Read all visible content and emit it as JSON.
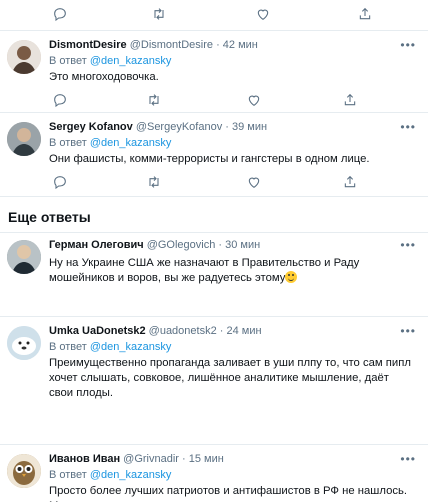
{
  "reply_prefix": "В ответ",
  "section_title": "Еще ответы",
  "tweets": [
    {
      "name": "DismontDesire",
      "handle": "@DismontDesire",
      "time": "42 мин",
      "reply_to": "@den_kazansky",
      "text": "Это многоходовочка.",
      "avatar_color": "#c9b8a6"
    },
    {
      "name": "Sergey Kofanov",
      "handle": "@SergeyKofanov",
      "time": "39 мин",
      "reply_to": "@den_kazansky",
      "text": "Они фашисты, комми-террористы и гангстеры в одном лице.",
      "avatar_color": "#8a8a8a"
    },
    {
      "name": "Герман Олегович",
      "handle": "@GOlegovich",
      "time": "30 мин",
      "reply_to": "",
      "text": "Ну на Украине США же назначают в Правительство и Раду мошейников и воров, вы же радуетесь этому",
      "avatar_color": "#7f8a90"
    },
    {
      "name": "Umka UaDonetsk2",
      "handle": "@uadonetsk2",
      "time": "24 мин",
      "reply_to": "@den_kazansky",
      "text": "Преимущественно пропаганда заливает в уши плпу то, что сам пипл хочет слышать, совковое, лишённое аналитике мышление, даёт свои плоды.",
      "avatar_color": "#d7e3ea"
    },
    {
      "name": "Иванов Иван",
      "handle": "@Grivnadir",
      "time": "15 мин",
      "reply_to": "@den_kazansky",
      "text": "Просто более лучших патриотов и антифашистов в РФ не нашлось. Маемо шо маемо.",
      "avatar_color": "#a58a5e"
    }
  ],
  "more_glyph": "•••",
  "dot": "·",
  "colors": {
    "link": "#1b95e0",
    "muted": "#5b7083",
    "separator": "#e6ecf0"
  }
}
